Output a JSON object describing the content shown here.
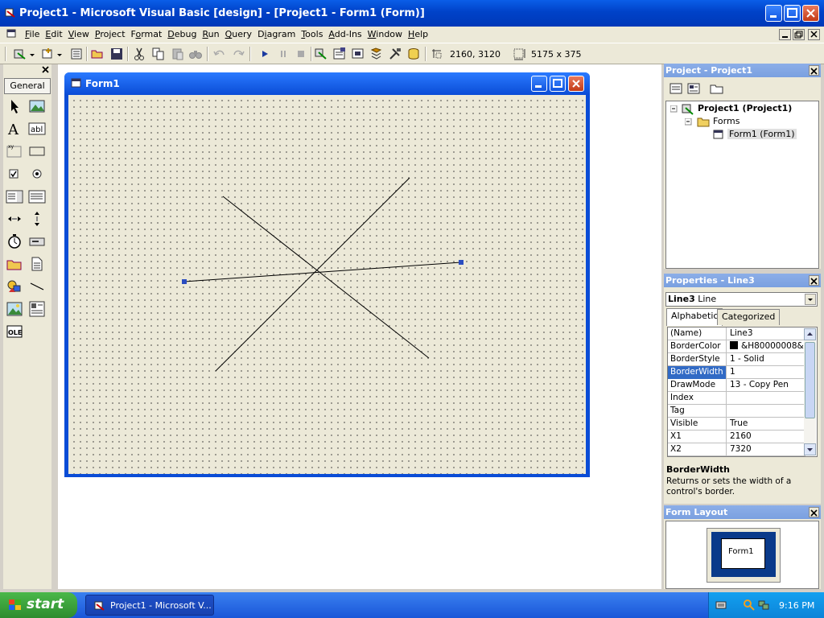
{
  "window": {
    "title": "Project1 - Microsoft Visual Basic [design] - [Project1 - Form1 (Form)]"
  },
  "menu": {
    "items": [
      {
        "label": "File",
        "accel": "F",
        "rest": "ile"
      },
      {
        "label": "Edit",
        "accel": "E",
        "rest": "dit"
      },
      {
        "label": "View",
        "accel": "V",
        "rest": "iew"
      },
      {
        "label": "Project",
        "accel": "P",
        "rest": "roject"
      },
      {
        "label": "Format",
        "accel": "o",
        "pre": "F",
        "rest": "rmat"
      },
      {
        "label": "Debug",
        "accel": "D",
        "rest": "ebug"
      },
      {
        "label": "Run",
        "accel": "R",
        "rest": "un"
      },
      {
        "label": "Query",
        "accel": "Q",
        "rest": "uery"
      },
      {
        "label": "Diagram",
        "accel": "i",
        "pre": "D",
        "rest": "agram"
      },
      {
        "label": "Tools",
        "accel": "T",
        "rest": "ools"
      },
      {
        "label": "Add-Ins",
        "accel": "A",
        "rest": "dd-Ins"
      },
      {
        "label": "Window",
        "accel": "W",
        "rest": "indow"
      },
      {
        "label": "Help",
        "accel": "H",
        "rest": "elp"
      }
    ]
  },
  "toolbar": {
    "position": "2160, 3120",
    "size": "5175 x 375"
  },
  "toolbox": {
    "tab_label": "General"
  },
  "form": {
    "title": "Form1"
  },
  "project_panel": {
    "title": "Project - Project1",
    "root": "Project1 (Project1)",
    "folder": "Forms",
    "item": "Form1 (Form1)"
  },
  "props_panel": {
    "title": "Properties - Line3",
    "object_name": "Line3",
    "object_type": "Line",
    "tab_alphabetic": "Alphabetic",
    "tab_categorized": "Categorized",
    "rows": [
      {
        "name": "(Name)",
        "value": "Line3"
      },
      {
        "name": "BorderColor",
        "value": "&H80000008&"
      },
      {
        "name": "BorderStyle",
        "value": "1 - Solid"
      },
      {
        "name": "BorderWidth",
        "value": "1"
      },
      {
        "name": "DrawMode",
        "value": "13 - Copy Pen"
      },
      {
        "name": "Index",
        "value": ""
      },
      {
        "name": "Tag",
        "value": ""
      },
      {
        "name": "Visible",
        "value": "True"
      },
      {
        "name": "X1",
        "value": "2160"
      },
      {
        "name": "X2",
        "value": "7320"
      }
    ],
    "desc_title": "BorderWidth",
    "desc_text": "Returns or sets the width of a control's border."
  },
  "layout_panel": {
    "title": "Form Layout",
    "form_label": "Form1"
  },
  "taskbar": {
    "start": "start",
    "task": "Project1 - Microsoft V...",
    "clock": "9:16 PM"
  }
}
